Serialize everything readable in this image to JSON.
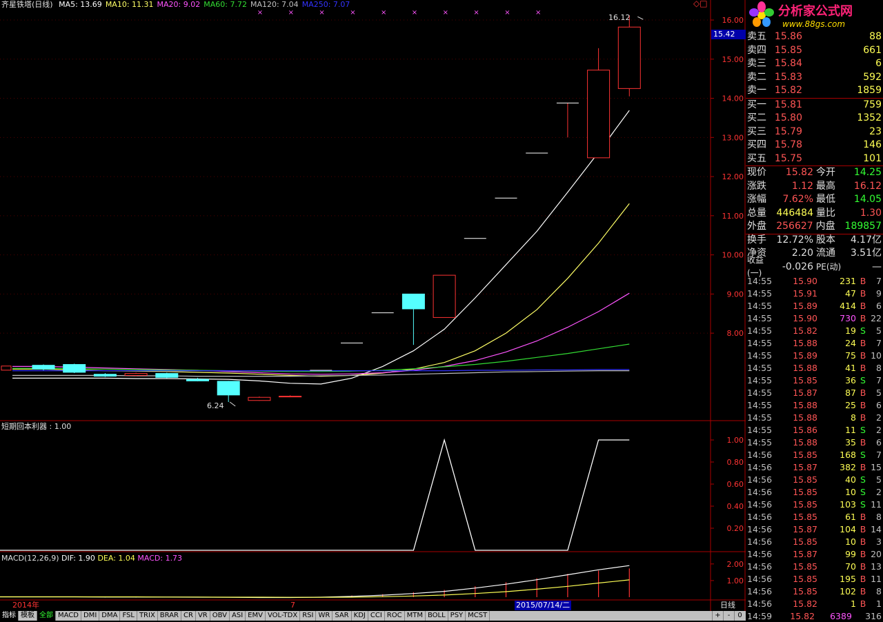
{
  "header": {
    "title": "齐星铁塔(日线)",
    "ma_items": [
      {
        "label": "MA5: 13.69",
        "color": "#ffffff"
      },
      {
        "label": "MA10: 11.31",
        "color": "#ffff66"
      },
      {
        "label": "MA20: 9.02",
        "color": "#ff55ff"
      },
      {
        "label": "MA60: 7.72",
        "color": "#33dd33"
      },
      {
        "label": "MA120: 7.04",
        "color": "#c0c0c0"
      },
      {
        "label": "MA250: 7.07",
        "color": "#3333ff"
      }
    ]
  },
  "logo": {
    "text": "分析家公式网",
    "url_text": "www.88gs.com"
  },
  "price_axis": {
    "current": "15.42",
    "high_label": "16.12",
    "low_label": "6.24",
    "ticks": [
      "16.00",
      "15.00",
      "14.00",
      "13.00",
      "12.00",
      "11.00",
      "10.00",
      "9.00",
      "8.00"
    ]
  },
  "sub1": {
    "title": "短期回本利器 : 1.00",
    "ticks": [
      "1.00",
      "0.80",
      "0.60",
      "0.40",
      "0.20"
    ]
  },
  "sub2": {
    "title_prefix": "MACD(12,26,9)",
    "dif": "DIF: 1.90",
    "dea": "DEA: 1.04",
    "macd": "MACD: 1.73",
    "ticks": [
      "2.00",
      "1.00"
    ]
  },
  "date_axis": {
    "left": "2014年",
    "mid": "7",
    "cursor": "2015/07/14/二",
    "period": "日线"
  },
  "order_book": {
    "sell": [
      {
        "name": "卖五",
        "price": "15.86",
        "vol": "88"
      },
      {
        "name": "卖四",
        "price": "15.85",
        "vol": "661"
      },
      {
        "name": "卖三",
        "price": "15.84",
        "vol": "6"
      },
      {
        "name": "卖二",
        "price": "15.83",
        "vol": "592"
      },
      {
        "name": "卖一",
        "price": "15.82",
        "vol": "1859"
      }
    ],
    "buy": [
      {
        "name": "买一",
        "price": "15.81",
        "vol": "759"
      },
      {
        "name": "买二",
        "price": "15.80",
        "vol": "1352"
      },
      {
        "name": "买三",
        "price": "15.79",
        "vol": "23"
      },
      {
        "name": "买四",
        "price": "15.78",
        "vol": "146"
      },
      {
        "name": "买五",
        "price": "15.75",
        "vol": "101"
      }
    ]
  },
  "stats": [
    {
      "l1": "现价",
      "v1": "15.82",
      "c1": "#ff5555",
      "l2": "今开",
      "v2": "14.25",
      "c2": "#33ff33"
    },
    {
      "l1": "涨跌",
      "v1": "1.12",
      "c1": "#ff5555",
      "l2": "最高",
      "v2": "16.12",
      "c2": "#ff5555"
    },
    {
      "l1": "涨幅",
      "v1": "7.62%",
      "c1": "#ff5555",
      "l2": "最低",
      "v2": "14.05",
      "c2": "#33ff33"
    },
    {
      "l1": "总量",
      "v1": "446484",
      "c1": "#ffff55",
      "l2": "量比",
      "v2": "1.30",
      "c2": "#ff5555"
    },
    {
      "l1": "外盘",
      "v1": "256627",
      "c1": "#ff5555",
      "l2": "内盘",
      "v2": "189857",
      "c2": "#33ff33"
    },
    {
      "l1": "换手",
      "v1": "12.72%",
      "c1": "#e0e0e0",
      "l2": "股本",
      "v2": "4.17亿",
      "c2": "#e0e0e0"
    },
    {
      "l1": "净资",
      "v1": "2.20",
      "c1": "#e0e0e0",
      "l2": "流通",
      "v2": "3.51亿",
      "c2": "#e0e0e0"
    },
    {
      "l1": "收益(一)",
      "v1": "-0.026",
      "c1": "#e0e0e0",
      "l2": "PE(动)",
      "v2": "—",
      "c2": "#e0e0e0"
    }
  ],
  "ticks": [
    {
      "t": "14:55",
      "p": "15.90",
      "v": "231",
      "b": "B",
      "c": "7"
    },
    {
      "t": "14:55",
      "p": "15.91",
      "v": "47",
      "b": "B",
      "c": "9"
    },
    {
      "t": "14:55",
      "p": "15.89",
      "v": "414",
      "b": "B",
      "c": "6"
    },
    {
      "t": "14:55",
      "p": "15.90",
      "v": "730",
      "b": "B",
      "c": "22"
    },
    {
      "t": "14:55",
      "p": "15.82",
      "v": "19",
      "b": "S",
      "c": "5"
    },
    {
      "t": "14:55",
      "p": "15.88",
      "v": "24",
      "b": "B",
      "c": "7"
    },
    {
      "t": "14:55",
      "p": "15.89",
      "v": "75",
      "b": "B",
      "c": "10"
    },
    {
      "t": "14:55",
      "p": "15.88",
      "v": "41",
      "b": "B",
      "c": "8"
    },
    {
      "t": "14:55",
      "p": "15.85",
      "v": "36",
      "b": "S",
      "c": "7"
    },
    {
      "t": "14:55",
      "p": "15.87",
      "v": "87",
      "b": "B",
      "c": "5"
    },
    {
      "t": "14:55",
      "p": "15.88",
      "v": "25",
      "b": "B",
      "c": "6"
    },
    {
      "t": "14:55",
      "p": "15.88",
      "v": "8",
      "b": "B",
      "c": "2"
    },
    {
      "t": "14:55",
      "p": "15.86",
      "v": "11",
      "b": "S",
      "c": "2"
    },
    {
      "t": "14:55",
      "p": "15.88",
      "v": "35",
      "b": "B",
      "c": "6"
    },
    {
      "t": "14:56",
      "p": "15.85",
      "v": "168",
      "b": "S",
      "c": "7"
    },
    {
      "t": "14:56",
      "p": "15.87",
      "v": "382",
      "b": "B",
      "c": "15"
    },
    {
      "t": "14:56",
      "p": "15.85",
      "v": "40",
      "b": "S",
      "c": "5"
    },
    {
      "t": "14:56",
      "p": "15.85",
      "v": "10",
      "b": "S",
      "c": "2"
    },
    {
      "t": "14:56",
      "p": "15.85",
      "v": "103",
      "b": "S",
      "c": "11"
    },
    {
      "t": "14:56",
      "p": "15.85",
      "v": "61",
      "b": "B",
      "c": "8"
    },
    {
      "t": "14:56",
      "p": "15.87",
      "v": "104",
      "b": "B",
      "c": "14"
    },
    {
      "t": "14:56",
      "p": "15.85",
      "v": "10",
      "b": "B",
      "c": "3"
    },
    {
      "t": "14:56",
      "p": "15.87",
      "v": "99",
      "b": "B",
      "c": "20"
    },
    {
      "t": "14:56",
      "p": "15.85",
      "v": "70",
      "b": "B",
      "c": "13"
    },
    {
      "t": "14:56",
      "p": "15.85",
      "v": "195",
      "b": "B",
      "c": "11"
    },
    {
      "t": "14:56",
      "p": "15.85",
      "v": "102",
      "b": "B",
      "c": "8"
    },
    {
      "t": "14:56",
      "p": "15.82",
      "v": "1",
      "b": "B",
      "c": "1"
    },
    {
      "t": "14:59",
      "p": "15.82",
      "v": "6389",
      "b": "",
      "c": "316"
    }
  ],
  "tabs": [
    "指标",
    "模板",
    "全部",
    "MACD",
    "DMI",
    "DMA",
    "FSL",
    "TRIX",
    "BRAR",
    "CR",
    "VR",
    "OBV",
    "ASI",
    "EMV",
    "VOL-TDX",
    "RSI",
    "WR",
    "SAR",
    "KDJ",
    "CCI",
    "ROC",
    "MTM",
    "BOLL",
    "PSY",
    "MCST"
  ],
  "bottom_right": [
    "+",
    "-",
    "0"
  ],
  "chart_data": {
    "type": "candlestick",
    "ylim": [
      5.8,
      16.3
    ],
    "candles": [
      {
        "o": 7.18,
        "c": 7.08,
        "h": 7.2,
        "l": 7.05,
        "up": true
      },
      {
        "o": 7.2,
        "c": 7.0,
        "h": 7.22,
        "l": 6.98,
        "up": false
      },
      {
        "o": 6.95,
        "c": 6.9,
        "h": 6.98,
        "l": 6.88,
        "up": false
      },
      {
        "o": 6.92,
        "c": 6.97,
        "h": 6.99,
        "l": 6.9,
        "up": true
      },
      {
        "o": 6.97,
        "c": 6.87,
        "h": 6.99,
        "l": 6.85,
        "up": false
      },
      {
        "o": 6.82,
        "c": 6.78,
        "h": 6.86,
        "l": 6.77,
        "up": false
      },
      {
        "o": 6.77,
        "c": 6.42,
        "h": 6.78,
        "l": 6.24,
        "up": false
      },
      {
        "o": 6.28,
        "c": 6.36,
        "h": 6.38,
        "l": 6.27,
        "up": true
      },
      {
        "o": 6.37,
        "c": 6.39,
        "h": 6.41,
        "l": 6.37,
        "up": true
      },
      {
        "o": 7.05,
        "c": 7.05,
        "h": 7.05,
        "l": 7.05,
        "up": true
      },
      {
        "o": 7.75,
        "c": 7.75,
        "h": 7.75,
        "l": 7.75,
        "up": true
      },
      {
        "o": 8.52,
        "c": 8.52,
        "h": 8.52,
        "l": 8.52,
        "up": true
      },
      {
        "o": 9.0,
        "c": 8.62,
        "h": 9.0,
        "l": 7.7,
        "up": false
      },
      {
        "o": 8.4,
        "c": 9.48,
        "h": 9.48,
        "l": 8.4,
        "up": true
      },
      {
        "o": 10.42,
        "c": 10.42,
        "h": 10.42,
        "l": 10.42,
        "up": true
      },
      {
        "o": 11.45,
        "c": 11.45,
        "h": 11.45,
        "l": 11.45,
        "up": true
      },
      {
        "o": 12.6,
        "c": 12.6,
        "h": 12.6,
        "l": 12.6,
        "up": true
      },
      {
        "o": 13.88,
        "c": 13.88,
        "h": 13.88,
        "l": 13.0,
        "up": true
      },
      {
        "o": 12.48,
        "c": 14.72,
        "h": 15.28,
        "l": 12.48,
        "up": true
      },
      {
        "o": 14.25,
        "c": 15.82,
        "h": 16.12,
        "l": 14.05,
        "up": true
      }
    ],
    "ma": [
      {
        "name": "MA5",
        "color": "#ffffff",
        "values": [
          6.85,
          6.85,
          6.85,
          6.84,
          6.84,
          6.83,
          6.82,
          6.78,
          6.72,
          6.7,
          6.85,
          7.15,
          7.55,
          8.1,
          8.9,
          9.75,
          10.6,
          11.6,
          12.62,
          13.69
        ]
      },
      {
        "name": "MA10",
        "color": "#ffff66",
        "values": [
          7.08,
          7.06,
          7.04,
          7.03,
          7.02,
          7.0,
          6.98,
          6.95,
          6.92,
          6.9,
          6.92,
          6.98,
          7.08,
          7.25,
          7.55,
          8.0,
          8.6,
          9.4,
          10.3,
          11.31
        ]
      },
      {
        "name": "MA20",
        "color": "#ff55ff",
        "values": [
          7.15,
          7.13,
          7.11,
          7.09,
          7.07,
          7.05,
          7.02,
          6.99,
          6.96,
          6.95,
          6.96,
          6.99,
          7.05,
          7.15,
          7.3,
          7.52,
          7.8,
          8.15,
          8.55,
          9.02
        ]
      },
      {
        "name": "MA60",
        "color": "#33dd33",
        "values": [
          7.1,
          7.09,
          7.08,
          7.07,
          7.06,
          7.05,
          7.04,
          7.03,
          7.02,
          7.02,
          7.03,
          7.05,
          7.09,
          7.14,
          7.2,
          7.28,
          7.38,
          7.48,
          7.6,
          7.72
        ]
      },
      {
        "name": "MA120",
        "color": "#c0c0c0",
        "values": [
          6.92,
          6.92,
          6.92,
          6.91,
          6.91,
          6.9,
          6.9,
          6.9,
          6.9,
          6.91,
          6.92,
          6.93,
          6.95,
          6.97,
          6.99,
          7.01,
          7.02,
          7.03,
          7.04,
          7.04
        ]
      },
      {
        "name": "MA250",
        "color": "#3333ff",
        "values": [
          7.04,
          7.04,
          7.04,
          7.04,
          7.04,
          7.04,
          7.04,
          7.04,
          7.04,
          7.04,
          7.04,
          7.04,
          7.04,
          7.04,
          7.05,
          7.05,
          7.06,
          7.06,
          7.07,
          7.07
        ]
      }
    ],
    "indicator": {
      "ylim": [
        0,
        1.05
      ],
      "values": [
        0,
        0,
        0,
        0,
        0,
        0,
        0,
        0,
        0,
        0,
        0,
        0,
        0,
        1,
        0,
        0,
        0,
        0,
        1,
        1
      ]
    },
    "macd": {
      "ylim": [
        -0.1,
        2.2
      ],
      "dif": [
        0.02,
        0.02,
        0.01,
        0.01,
        0.01,
        0.0,
        -0.01,
        -0.02,
        -0.02,
        0.0,
        0.05,
        0.12,
        0.22,
        0.35,
        0.55,
        0.78,
        1.05,
        1.35,
        1.65,
        1.9
      ],
      "dea": [
        0.02,
        0.02,
        0.02,
        0.02,
        0.01,
        0.01,
        0.0,
        0.0,
        -0.01,
        -0.01,
        0.0,
        0.03,
        0.07,
        0.13,
        0.22,
        0.33,
        0.48,
        0.65,
        0.85,
        1.04
      ],
      "bars": [
        0.0,
        0.0,
        -0.02,
        -0.02,
        0.0,
        -0.02,
        -0.02,
        -0.04,
        -0.02,
        0.02,
        0.1,
        0.18,
        0.3,
        0.44,
        0.66,
        0.9,
        1.14,
        1.4,
        1.6,
        1.73
      ]
    },
    "signal_marks": 10
  }
}
